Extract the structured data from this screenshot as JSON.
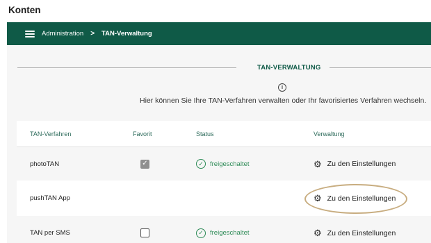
{
  "page": {
    "title": "Konten"
  },
  "navbar": {
    "breadcrumb": [
      {
        "label": "Administration"
      },
      {
        "label": "TAN-Verwaltung"
      }
    ],
    "separator": ">"
  },
  "section": {
    "title": "TAN-VERWALTUNG",
    "info_text": "Hier können Sie Ihre TAN-Verfahren verwalten oder Ihr favorisiertes Verfahren wechseln."
  },
  "table": {
    "columns": [
      "TAN-Verfahren",
      "Favorit",
      "Status",
      "Verwaltung"
    ],
    "rows": [
      {
        "method": "photoTAN",
        "favorite": "checked",
        "status": "freigeschaltet",
        "action": "Zu den Einstellungen"
      },
      {
        "method": "pushTAN App",
        "favorite": "none",
        "status": "",
        "action": "Zu den Einstellungen"
      },
      {
        "method": "TAN per SMS",
        "favorite": "unchecked",
        "status": "freigeschaltet",
        "action": "Zu den Einstellungen"
      }
    ]
  },
  "colors": {
    "navbar": "#0f5a47",
    "status_green": "#2e8b57",
    "highlight_ring": "#c8ad80"
  },
  "icons": [
    "menu-icon",
    "info-icon",
    "check-circle-icon",
    "gear-icon"
  ]
}
